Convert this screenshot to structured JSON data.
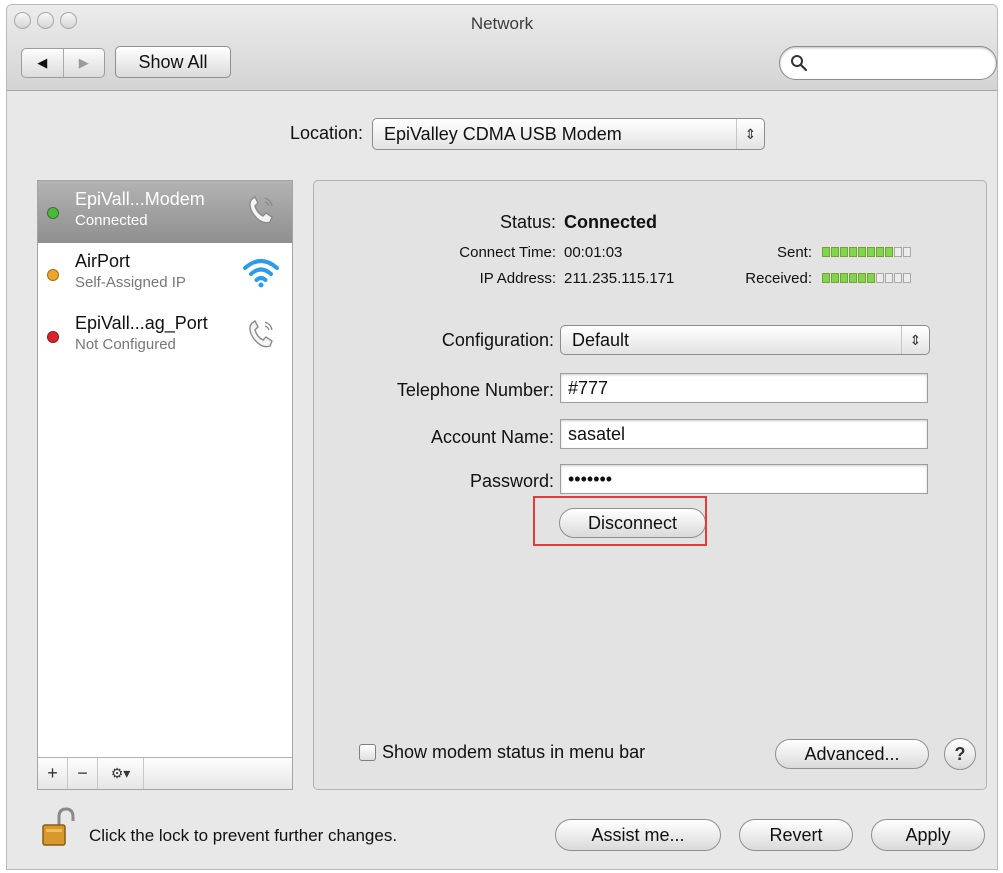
{
  "window": {
    "title": "Network"
  },
  "toolbar": {
    "back": "◀",
    "forward": "▶",
    "show_all": "Show All",
    "search_value": ""
  },
  "location": {
    "label": "Location:",
    "value": "EpiValley CDMA USB Modem"
  },
  "services": [
    {
      "name": "EpiVall...Modem",
      "status": "Connected",
      "dot_color": "#4cb83a",
      "icon": "phone-modem-icon",
      "selected": true
    },
    {
      "name": "AirPort",
      "status": "Self-Assigned IP",
      "dot_color": "#f0a62a",
      "icon": "wifi-icon",
      "selected": false
    },
    {
      "name": "EpiVall...ag_Port",
      "status": "Not Configured",
      "dot_color": "#d9252a",
      "icon": "phone-modem-icon",
      "selected": false
    }
  ],
  "sidebar_tools": {
    "add": "+",
    "remove": "−",
    "action": "⚙▾"
  },
  "status": {
    "status_label": "Status:",
    "status_value": "Connected",
    "connect_time_label": "Connect Time:",
    "connect_time_value": "00:01:03",
    "ip_label": "IP Address:",
    "ip_value": "211.235.115.171",
    "sent_label": "Sent:",
    "received_label": "Received:",
    "sent_level": 0.8,
    "received_level": 0.6
  },
  "form": {
    "configuration_label": "Configuration:",
    "configuration_value": "Default",
    "telephone_label": "Telephone Number:",
    "telephone_value": "#777",
    "account_label": "Account Name:",
    "account_value": "sasatel",
    "password_label": "Password:",
    "password_value": "•••••••",
    "disconnect_label": "Disconnect"
  },
  "panel_footer": {
    "show_modem_status_label": "Show modem status in menu bar",
    "advanced_label": "Advanced...",
    "help_label": "?"
  },
  "footer": {
    "lock_text": "Click the lock to prevent further changes.",
    "assist_label": "Assist me...",
    "revert_label": "Revert",
    "apply_label": "Apply"
  },
  "colors": {
    "highlight": "#e53a3a",
    "selected_row": "#9f9f9f",
    "meter_on": "#7fd84a"
  }
}
